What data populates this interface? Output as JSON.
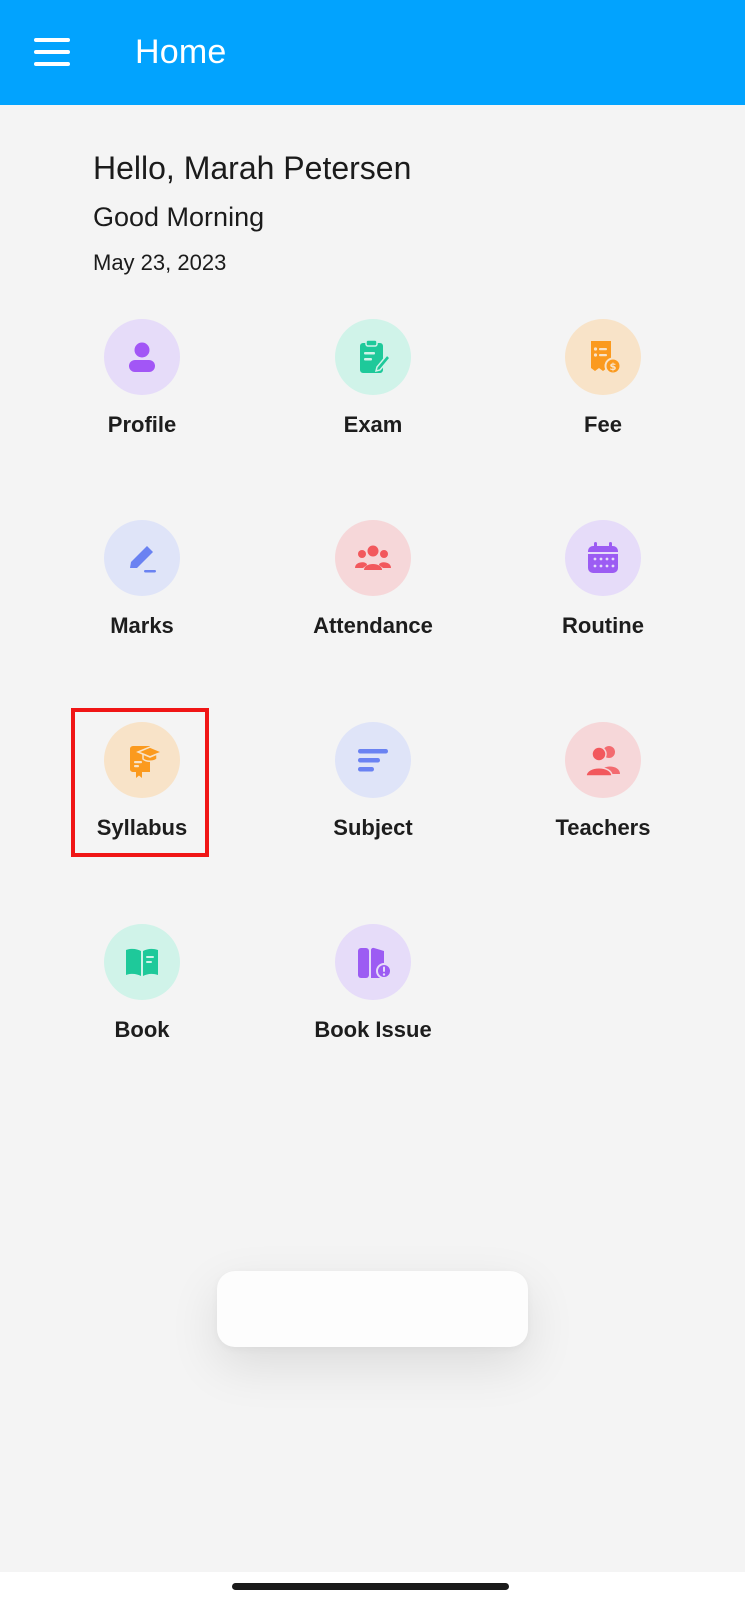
{
  "header": {
    "title": "Home",
    "menu_icon": "hamburger-menu-icon",
    "background": "#02a3fe"
  },
  "greeting": {
    "hello": "Hello, Marah Petersen",
    "salutation": "Good Morning",
    "date": "May 23, 2023"
  },
  "tiles": [
    {
      "label": "Profile",
      "icon": "profile-icon",
      "bg": "#e6dcf9",
      "color": "#a256f6"
    },
    {
      "label": "Exam",
      "icon": "exam-clipboard-icon",
      "bg": "#d0f3e9",
      "color": "#1ec99a"
    },
    {
      "label": "Fee",
      "icon": "fee-receipt-icon",
      "bg": "#f8e3c8",
      "color": "#fb9a1e"
    },
    {
      "label": "Marks",
      "icon": "marks-pencil-icon",
      "bg": "#dfe4f8",
      "color": "#6a82f2"
    },
    {
      "label": "Attendance",
      "icon": "attendance-group-icon",
      "bg": "#f6d7d9",
      "color": "#f2585d"
    },
    {
      "label": "Routine",
      "icon": "routine-calendar-icon",
      "bg": "#e6dcf9",
      "color": "#9c5cf3"
    },
    {
      "label": "Syllabus",
      "icon": "syllabus-book-cap-icon",
      "bg": "#f8e3c8",
      "color": "#fb9a1e"
    },
    {
      "label": "Subject",
      "icon": "subject-lines-icon",
      "bg": "#dfe4f8",
      "color": "#6a82f2"
    },
    {
      "label": "Teachers",
      "icon": "teachers-people-icon",
      "bg": "#f6d7d9",
      "color": "#f2585d"
    },
    {
      "label": "Book",
      "icon": "book-open-icon",
      "bg": "#d0f3e9",
      "color": "#1ec99a"
    },
    {
      "label": "Book Issue",
      "icon": "book-issue-icon",
      "bg": "#e6dcf9",
      "color": "#9c5cf3"
    }
  ],
  "highlight_color": "#f01515"
}
